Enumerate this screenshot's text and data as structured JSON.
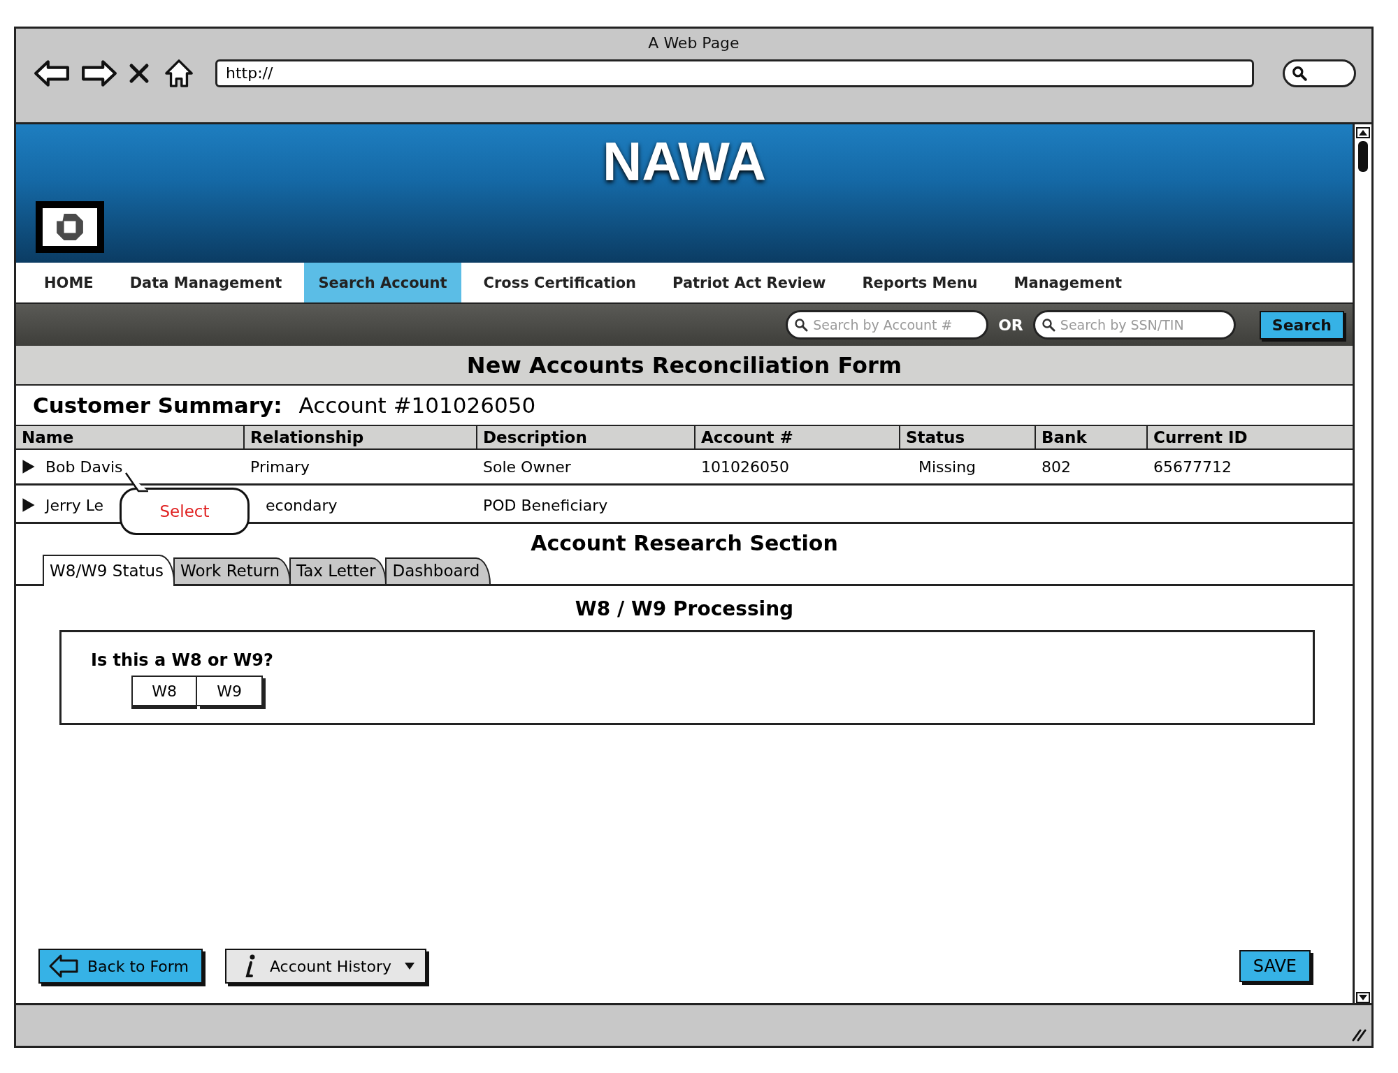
{
  "browser": {
    "title": "A Web Page",
    "address": "http://"
  },
  "banner": {
    "title": "NAWA"
  },
  "menu": [
    {
      "label": "HOME",
      "selected": false
    },
    {
      "label": "Data Management",
      "selected": false
    },
    {
      "label": "Search Account",
      "selected": true
    },
    {
      "label": "Cross Certification",
      "selected": false
    },
    {
      "label": "Patriot Act Review",
      "selected": false
    },
    {
      "label": "Reports Menu",
      "selected": false
    },
    {
      "label": "Management",
      "selected": false
    }
  ],
  "search": {
    "account_placeholder": "Search by Account #",
    "or_label": "OR",
    "ssn_placeholder": "Search by SSN/TIN",
    "button": "Search"
  },
  "form_title": "New Accounts Reconciliation Form",
  "summary": {
    "label": "Customer Summary:",
    "account": "Account #101026050"
  },
  "table": {
    "columns": [
      "Name",
      "Relationship",
      "Description",
      "Account #",
      "Status",
      "Bank",
      "Current ID"
    ],
    "rows": [
      {
        "cells": [
          "Bob Davis",
          "Primary",
          "Sole Owner",
          "101026050",
          "Missing",
          "802",
          "65677712"
        ]
      },
      {
        "cells": [
          "Jerry Le",
          "econdary",
          "POD Beneficiary"
        ]
      }
    ]
  },
  "callout": {
    "label": "Select"
  },
  "research": {
    "title": "Account Research Section",
    "tabs": [
      {
        "label": "W8/W9 Status",
        "selected": true
      },
      {
        "label": "Work Return",
        "selected": false
      },
      {
        "label": "Tax Letter",
        "selected": false
      },
      {
        "label": "Dashboard",
        "selected": false
      }
    ],
    "heading": "W8 / W9 Processing",
    "question": "Is this a W8 or W9?",
    "options": [
      {
        "label": "W8",
        "selected": false
      },
      {
        "label": "W9",
        "selected": false
      }
    ]
  },
  "footer": {
    "back_button": "Back to Form",
    "history_button": "Account History",
    "save_button": "SAVE"
  }
}
